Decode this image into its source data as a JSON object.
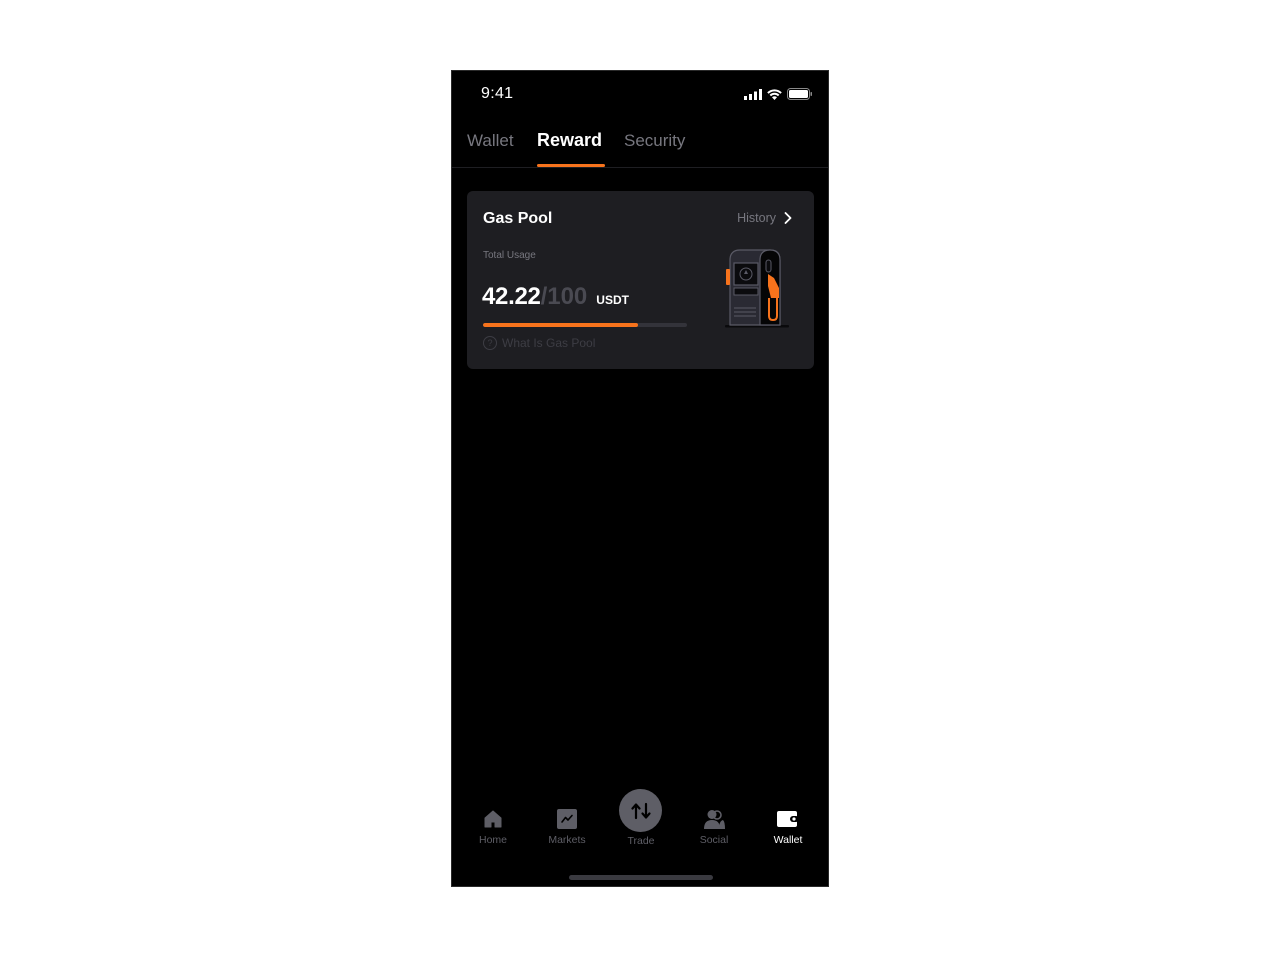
{
  "status_bar": {
    "time": "9:41",
    "icons": [
      "cellular-signal-icon",
      "wifi-icon",
      "battery-icon"
    ]
  },
  "tabs": [
    {
      "label": "Wallet",
      "active": false
    },
    {
      "label": "Reward",
      "active": true
    },
    {
      "label": "Security",
      "active": false
    }
  ],
  "gas_pool": {
    "title": "Gas Pool",
    "history_label": "History",
    "usage_label": "Total Usage",
    "usage_value": "42.22",
    "usage_separator": "/",
    "usage_total": "100",
    "usage_unit": "USDT",
    "progress_fraction": 0.76,
    "help_label": "What Is Gas Pool",
    "accent_color": "#f7731c",
    "illustration": "gas-pump-illustration"
  },
  "bottom_nav": {
    "items": [
      {
        "label": "Home",
        "icon": "home-icon",
        "active": false
      },
      {
        "label": "Markets",
        "icon": "chart-icon",
        "active": false
      },
      {
        "label": "Trade",
        "icon": "swap-arrows-icon",
        "active": false
      },
      {
        "label": "Social",
        "icon": "users-icon",
        "active": false
      },
      {
        "label": "Wallet",
        "icon": "wallet-icon",
        "active": true
      }
    ]
  }
}
